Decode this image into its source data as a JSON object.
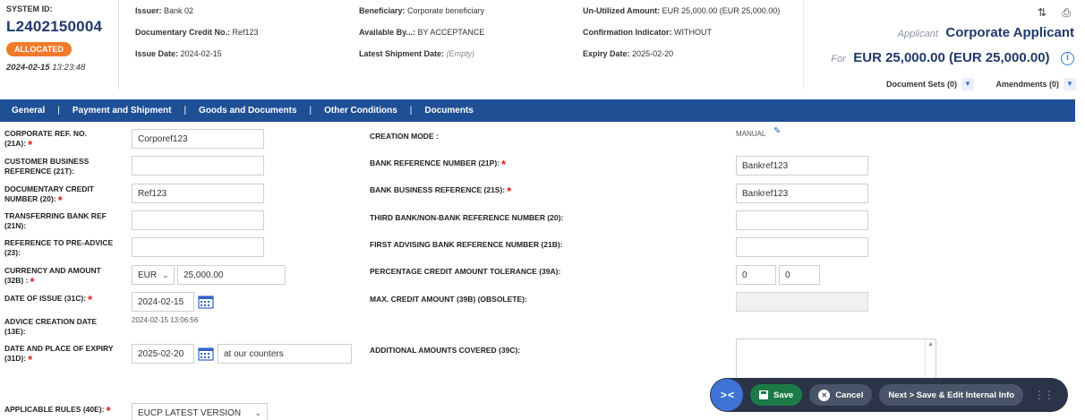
{
  "header": {
    "system_id_label": "SYSTEM ID:",
    "system_id": "L2402150004",
    "status": "ALLOCATED",
    "timestamp_date": "2024-02-15",
    "timestamp_time": "13:23:48",
    "col1": [
      {
        "label": "Issuer:",
        "value": "Bank 02"
      },
      {
        "label": "Documentary Credit No.:",
        "value": "Ref123"
      },
      {
        "label": "Issue Date:",
        "value": "2024-02-15"
      }
    ],
    "col2": [
      {
        "label": "Beneficiary:",
        "value": "Corporate beneficiary"
      },
      {
        "label": "Available By...:",
        "value": "BY ACCEPTANCE"
      },
      {
        "label": "Latest Shipment Date:",
        "value": "(Empty)"
      }
    ],
    "col3": [
      {
        "label": "Un-Utilized Amount:",
        "value": "EUR 25,000.00 (EUR 25,000.00)"
      },
      {
        "label": "Confirmation Indicator:",
        "value": "WITHOUT"
      },
      {
        "label": "Expiry Date:",
        "value": "2025-02-20"
      }
    ],
    "applicant_caption": "Applicant",
    "applicant_name": "Corporate Applicant",
    "for_caption": "For",
    "amount": "EUR 25,000.00 (EUR 25,000.00)",
    "document_sets": "Document Sets (0)",
    "amendments": "Amendments (0)"
  },
  "tabs": [
    "General",
    "Payment and Shipment",
    "Goods and Documents",
    "Other Conditions",
    "Documents"
  ],
  "form": {
    "corp_ref_label": "CORPORATE REF. NO. (21A):",
    "corp_ref_value": "Corporef123",
    "cust_ref_label": "CUSTOMER BUSINESS REFERENCE (21T):",
    "cust_ref_value": "",
    "dc_number_label": "DOCUMENTARY CREDIT NUMBER (20):",
    "dc_number_value": "Ref123",
    "transfer_ref_label": "TRANSFERRING BANK REF (21N):",
    "transfer_ref_value": "",
    "pre_advice_label": "REFERENCE TO PRE-ADVICE (23):",
    "pre_advice_value": "",
    "currency_label": "CURRENCY AND AMOUNT (32B) :",
    "currency_value": "EUR",
    "amount_value": "25,000.00",
    "issue_date_label": "DATE OF ISSUE (31C):",
    "issue_date_value": "2024-02-15",
    "advice_date_label": "ADVICE CREATION DATE (13E):",
    "advice_date_value": "2024-02-15 13:06:56",
    "expiry_label": "DATE AND PLACE OF EXPIRY (31D):",
    "expiry_date_value": "2025-02-20",
    "expiry_place_value": "at our counters",
    "rules_label": "APPLICABLE RULES (40E):",
    "rules_value": "EUCP LATEST VERSION",
    "creation_mode_label": "CREATION MODE :",
    "creation_mode_value": "MANUAL",
    "bank_ref_label": "BANK REFERENCE NUMBER (21P):",
    "bank_ref_value": "Bankref123",
    "bank_biz_ref_label": "BANK BUSINESS REFERENCE (21S):",
    "bank_biz_ref_value": "Bankref123",
    "third_bank_label": "THIRD BANK/NON-BANK REFERENCE NUMBER (20):",
    "third_bank_value": "",
    "first_adv_label": "FIRST ADVISING BANK REFERENCE NUMBER (21B):",
    "first_adv_value": "",
    "tolerance_label": "PERCENTAGE CREDIT AMOUNT TOLERANCE (39A):",
    "tolerance_plus": "0",
    "tolerance_minus": "0",
    "max_credit_label": "MAX. CREDIT AMOUNT (39B) (OBSOLETE):",
    "additional_label": "ADDITIONAL AMOUNTS COVERED (39C):"
  },
  "actions": {
    "save": "Save",
    "cancel": "Cancel",
    "next": "Next > Save & Edit Internal Info"
  },
  "colors": {
    "tabbar": "#1f4f94",
    "brand_text": "#1f3a6b",
    "status_badge": "#f07b2a",
    "required": "#e01e1e",
    "save_button": "#1c7a46",
    "actionbar": "#2a3347"
  }
}
